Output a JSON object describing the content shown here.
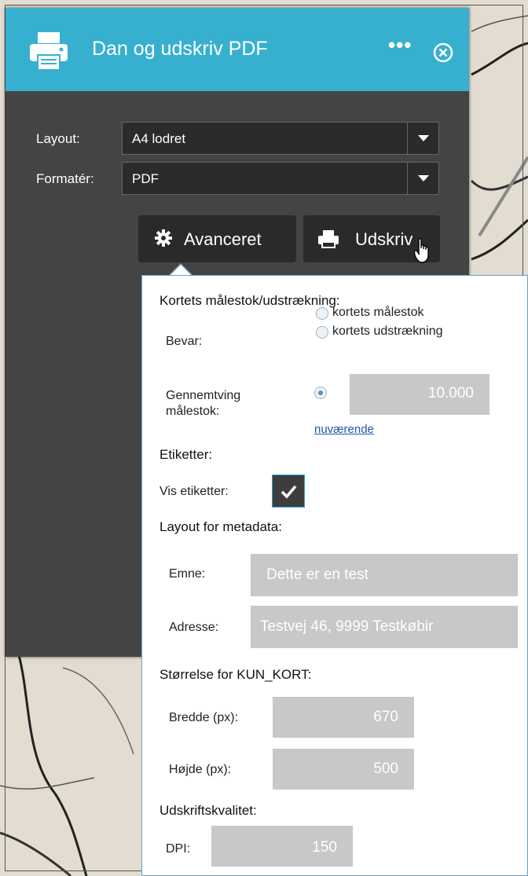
{
  "window": {
    "title": "Dan og udskriv PDF",
    "more_label": "•••"
  },
  "form": {
    "layout_label": "Layout:",
    "layout_value": "A4 lodret",
    "format_label": "Formatér:",
    "format_value": "PDF"
  },
  "buttons": {
    "advanced": "Avanceret",
    "print": "Udskriv"
  },
  "advanced": {
    "scale_heading": "Kortets målestok/udstrækning:",
    "preserve_label": "Bevar:",
    "preserve_options": [
      "kortets målestok",
      "kortets udstrækning"
    ],
    "force_scale_label_1": "Gennemtving",
    "force_scale_label_2": "målestok:",
    "force_scale_value": "10.000",
    "current_link": "nuværende",
    "labels_heading": "Etiketter:",
    "show_labels_label": "Vis etiketter:",
    "show_labels_checked": true,
    "metadata_heading": "Layout for metadata:",
    "subject_label": "Emne:",
    "subject_value": "Dette er en test",
    "address_label": "Adresse:",
    "address_value": "Testvej 46, 9999 Testkøbir",
    "mapsize_heading": "Størrelse for KUN_KORT:",
    "width_label": "Bredde (px):",
    "width_value": "670",
    "height_label": "Højde (px):",
    "height_value": "500",
    "quality_heading": "Udskriftskvalitet:",
    "dpi_label": "DPI:",
    "dpi_value": "150"
  },
  "colors": {
    "header": "#37b0d0",
    "panel": "#444444",
    "input_disabled": "#c8c8c8"
  },
  "icons": [
    "printer-icon",
    "close-icon",
    "gear-icon",
    "print-icon",
    "hand-cursor-icon",
    "checkmark-icon"
  ]
}
